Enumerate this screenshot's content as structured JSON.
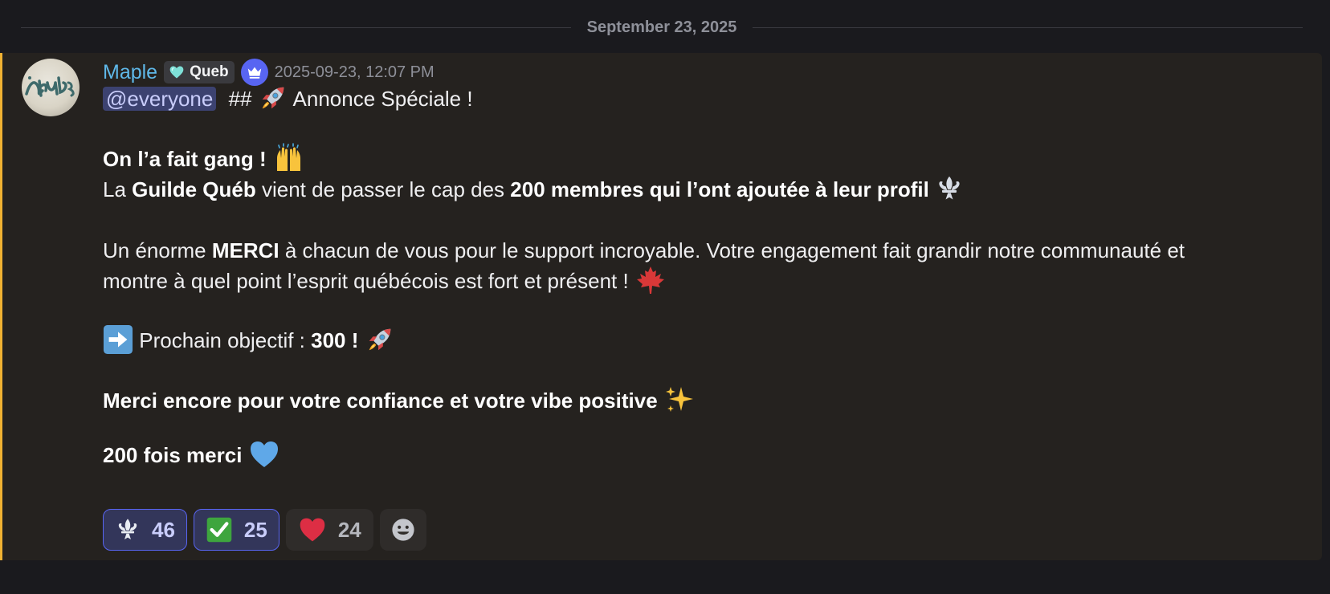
{
  "date_divider": "September 23, 2025",
  "message": {
    "author": "Maple",
    "guild_tag": "Queb",
    "timestamp": "2025-09-23, 12:07 PM",
    "accent_color": "#f0b232",
    "username_color": "#5fb8e8",
    "line1": {
      "mention": "@everyone",
      "prefix": "##",
      "text": "Annonce Spéciale !"
    },
    "line2": {
      "bold": "On l’a fait gang !"
    },
    "line3": {
      "t1": "La",
      "b1": "Guilde Québ",
      "t2": "vient de passer le cap des",
      "b2": "200 membres qui l’ont ajoutée à leur profil"
    },
    "line4": {
      "t1": "Un énorme",
      "b1": "MERCI",
      "t2": "à chacun de vous pour le support incroyable. Votre engagement fait grandir notre communauté et"
    },
    "line5": {
      "text": "montre à quel point l’esprit québécois est fort et présent !"
    },
    "line6": {
      "text": "Prochain objectif :",
      "bold": "300 !"
    },
    "line7": {
      "bold": "Merci encore pour votre confiance et votre vibe positive"
    },
    "line8": {
      "bold": "200 fois merci"
    }
  },
  "reactions": [
    {
      "emoji": "fleur-de-lis",
      "count": "46",
      "active": true
    },
    {
      "emoji": "check-mark",
      "count": "25",
      "active": true
    },
    {
      "emoji": "red-heart",
      "count": "24",
      "active": false
    }
  ]
}
